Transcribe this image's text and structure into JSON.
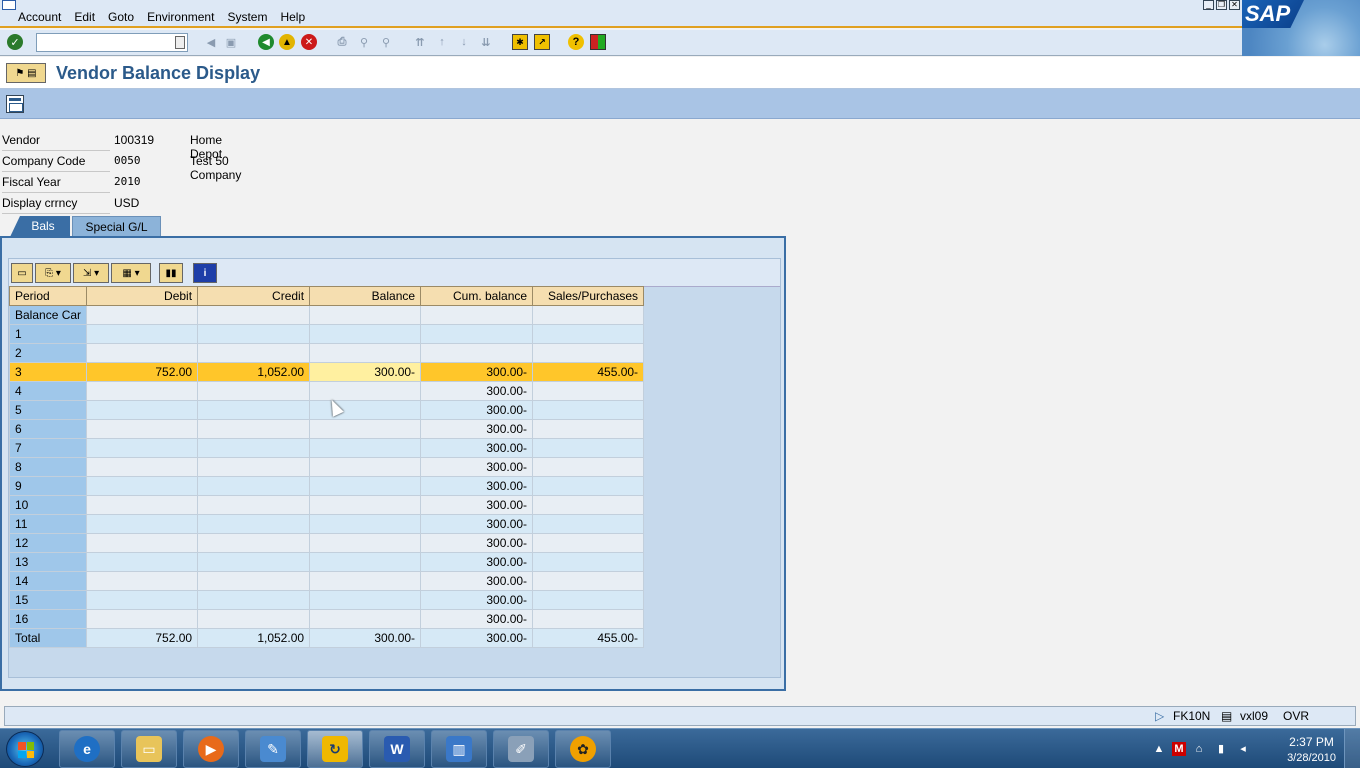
{
  "menu": [
    "Account",
    "Edit",
    "Goto",
    "Environment",
    "System",
    "Help"
  ],
  "sap_logo_text": "SAP",
  "page_title": "Vendor Balance Display",
  "header_fields": [
    {
      "label": "Vendor",
      "value": "100319",
      "desc": "Home Depot",
      "mono": false
    },
    {
      "label": "Company Code",
      "value": "0050",
      "desc": "Test 50 Company",
      "mono": true
    },
    {
      "label": "Fiscal Year",
      "value": "2010",
      "desc": "",
      "mono": true
    },
    {
      "label": "Display crrncy",
      "value": "USD",
      "desc": "",
      "mono": false
    }
  ],
  "tabs": {
    "active": "Bals",
    "inactive": "Special G/L"
  },
  "grid": {
    "columns": [
      "Period",
      "Debit",
      "Credit",
      "Balance",
      "Cum. balance",
      "Sales/Purchases"
    ],
    "rows": [
      [
        "Balance Car",
        "",
        "",
        "",
        "",
        ""
      ],
      [
        "1",
        "",
        "",
        "",
        "",
        ""
      ],
      [
        "2",
        "",
        "",
        "",
        "",
        ""
      ],
      [
        "3",
        "752.00",
        "1,052.00",
        "300.00-",
        "300.00-",
        "455.00-"
      ],
      [
        "4",
        "",
        "",
        "",
        "300.00-",
        ""
      ],
      [
        "5",
        "",
        "",
        "",
        "300.00-",
        ""
      ],
      [
        "6",
        "",
        "",
        "",
        "300.00-",
        ""
      ],
      [
        "7",
        "",
        "",
        "",
        "300.00-",
        ""
      ],
      [
        "8",
        "",
        "",
        "",
        "300.00-",
        ""
      ],
      [
        "9",
        "",
        "",
        "",
        "300.00-",
        ""
      ],
      [
        "10",
        "",
        "",
        "",
        "300.00-",
        ""
      ],
      [
        "11",
        "",
        "",
        "",
        "300.00-",
        ""
      ],
      [
        "12",
        "",
        "",
        "",
        "300.00-",
        ""
      ],
      [
        "13",
        "",
        "",
        "",
        "300.00-",
        ""
      ],
      [
        "14",
        "",
        "",
        "",
        "300.00-",
        ""
      ],
      [
        "15",
        "",
        "",
        "",
        "300.00-",
        ""
      ],
      [
        "16",
        "",
        "",
        "",
        "300.00-",
        ""
      ]
    ],
    "total": [
      "Total",
      "752.00",
      "1,052.00",
      "300.00-",
      "300.00-",
      "455.00-"
    ],
    "selected_row": 3
  },
  "status": {
    "transaction": "FK10N",
    "server": "vxl09",
    "mode": "OVR"
  },
  "clock": {
    "time": "2:37 PM",
    "date": "3/28/2010"
  },
  "colors": {
    "accent": "#3a6ea5",
    "selected_row": "#ffc62a",
    "header_bg": "#f5deb0",
    "title_text": "#2b5a8a"
  }
}
